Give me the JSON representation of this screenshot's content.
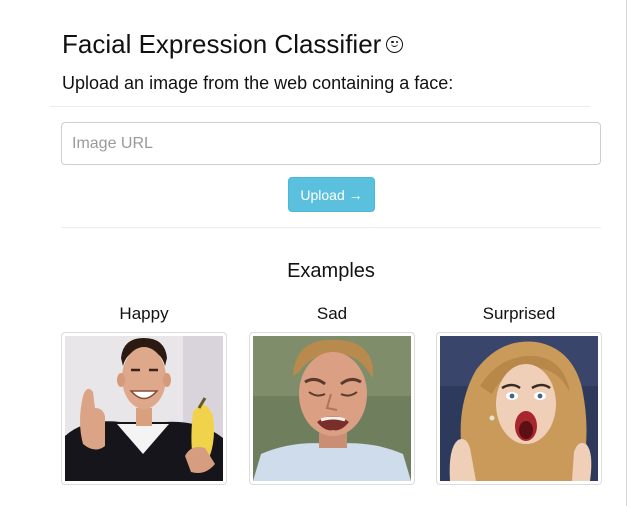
{
  "page": {
    "title": "Facial Expression Classifier",
    "title_icon": "smiley-face-icon",
    "subtitle": "Upload an image from the web containing a face:"
  },
  "form": {
    "url_placeholder": "Image URL",
    "url_value": "",
    "upload_label": "Upload →",
    "upload_color": "#5bc0de"
  },
  "examples": {
    "heading": "Examples",
    "items": [
      {
        "label": "Happy"
      },
      {
        "label": "Sad"
      },
      {
        "label": "Surprised"
      }
    ]
  }
}
